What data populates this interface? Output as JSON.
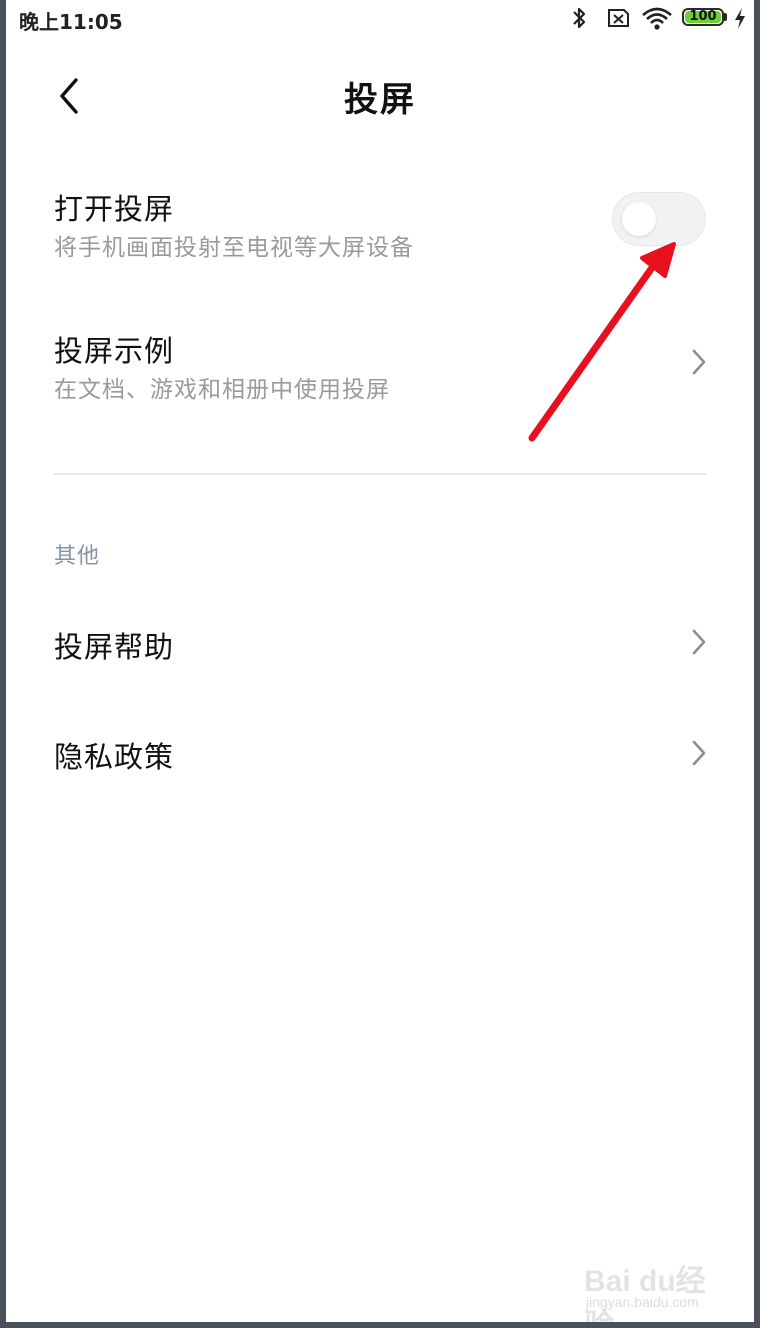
{
  "status_bar": {
    "time": "晚上11:05",
    "battery": "100",
    "icons": [
      "bluetooth-icon",
      "sim-x-icon",
      "wifi-icon",
      "battery-icon",
      "charging-icon"
    ]
  },
  "header": {
    "title": "投屏",
    "back_icon": "back-chevron-icon"
  },
  "settings": {
    "open_cast": {
      "title": "打开投屏",
      "subtitle": "将手机画面投射至电视等大屏设备",
      "toggle_on": false
    },
    "examples": {
      "title": "投屏示例",
      "subtitle": "在文档、游戏和相册中使用投屏"
    }
  },
  "other_section": {
    "label": "其他",
    "items": [
      {
        "title": "投屏帮助"
      },
      {
        "title": "隐私政策"
      }
    ]
  },
  "annotation": {
    "color": "#e8101e"
  },
  "watermark": {
    "main": "Bai du经验",
    "sub": "jingyan.baidu.com"
  },
  "colors": {
    "accent_label": "#8592a8",
    "subtitle": "#9a9a9a",
    "battery": "#6dcf3a"
  }
}
